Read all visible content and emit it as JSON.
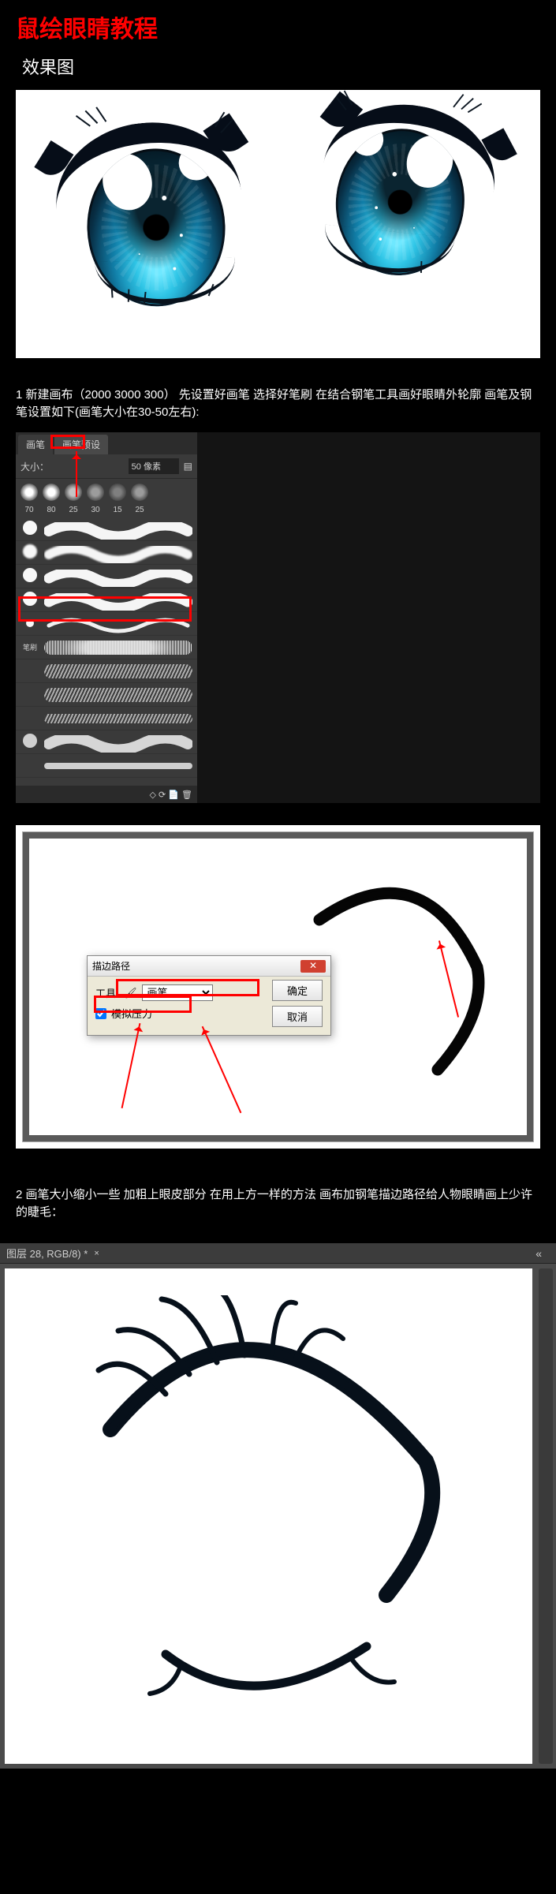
{
  "title": "鼠绘眼睛教程",
  "section_result": "效果图",
  "step1": "1  新建画布（2000  3000 300）  先设置好画笔  选择好笔刷  在结合钢笔工具画好眼睛外轮廓  画笔及钢笔设置如下(画笔大小在30-50左右):",
  "step2": "2  画笔大小缩小一些  加粗上眼皮部分  在用上方一样的方法  画布加钢笔描边路径给人物眼睛画上少许的睫毛：",
  "brush_panel": {
    "tab1": "画笔",
    "tab2": "画笔预设",
    "size_label": "大小：",
    "size_value": "50 像素",
    "preset_sizes": [
      "70",
      "80",
      "25",
      "30",
      "15",
      "25"
    ],
    "section_label": "笔刷",
    "footer_icons": "◇  ⟳  📄  🗑"
  },
  "dialog": {
    "title": "描边路径",
    "tool_label": "工具:",
    "tool_value": "画笔",
    "sim_pressure": "模拟压力",
    "ok": "确定",
    "cancel": "取消"
  },
  "tab4_title": "图层 28, RGB/8) *"
}
